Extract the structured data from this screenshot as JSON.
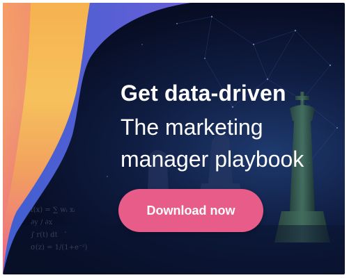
{
  "ad": {
    "headline": "Get data-driven",
    "subline_line1": "The marketing",
    "subline_line2": "manager playbook",
    "cta_label": "Download now"
  },
  "formula_lines": [
    "f(x) = ∑ wᵢ xᵢ",
    "∂y / ∂x",
    "∫ r(t) dt",
    "σ(z) = 1/(1+e⁻ᶻ)"
  ],
  "colors": {
    "background": "#070d24",
    "cta": "#e85c8a",
    "wave_yellow": "#f7c35a",
    "wave_orange": "#f29a64",
    "wave_pink": "#ec6e86",
    "wave_blue": "#3c64d6"
  }
}
